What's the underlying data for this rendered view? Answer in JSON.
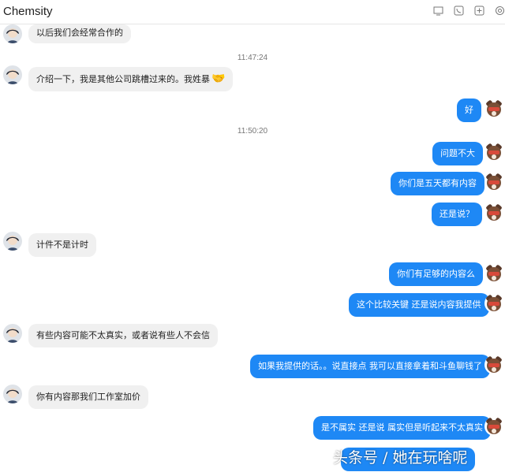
{
  "window": {
    "title": "Chemsity"
  },
  "header_icons": [
    "screen-share-icon",
    "phone-icon",
    "add-icon",
    "settings-icon"
  ],
  "timestamps": [
    "11:47:24",
    "11:50:20"
  ],
  "messages": [
    {
      "side": "in",
      "text": "以后我们会经常合作的"
    },
    {
      "side": "in",
      "text": "介绍一下，我是其他公司跳槽过来的。我姓暴",
      "emoji": "🤝"
    },
    {
      "side": "out",
      "text": "好"
    },
    {
      "side": "out",
      "text": "问题不大"
    },
    {
      "side": "out",
      "text": "你们是五天都有内容"
    },
    {
      "side": "out",
      "text": "还是说？"
    },
    {
      "side": "in",
      "text": "计件不是计时"
    },
    {
      "side": "out",
      "text": "你们有足够的内容么"
    },
    {
      "side": "out",
      "text": "这个比较关键 还是说内容我提供"
    },
    {
      "side": "in",
      "text": "有些内容可能不太真实，或者说有些人不会信"
    },
    {
      "side": "out",
      "text": "如果我提供的话。。说直接点 我可以直接拿着和斗鱼聊钱了"
    },
    {
      "side": "in",
      "text": "你有内容那我们工作室加价"
    },
    {
      "side": "out",
      "text": "是不属实 还是说 属实但是听起来不太真实"
    }
  ],
  "watermark": "头条号 / 她在玩啥呢",
  "colors": {
    "outgoing_bubble": "#1e88f5",
    "incoming_bubble": "#f0f0f0"
  }
}
